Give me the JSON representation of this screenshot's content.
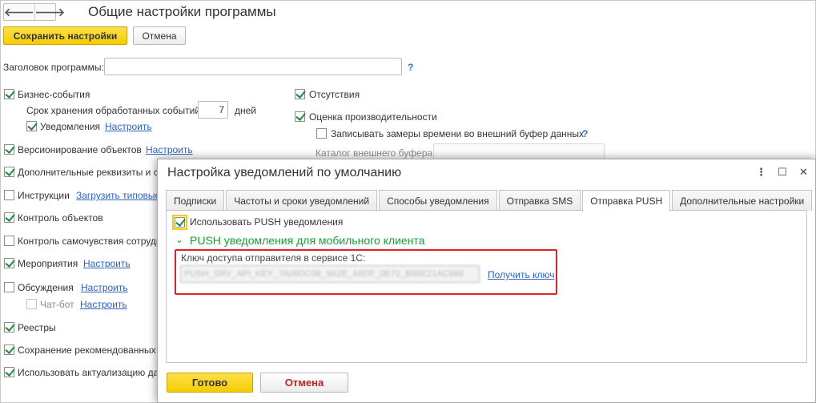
{
  "app": {
    "nav": {
      "back_glyph": "🡐",
      "forward_glyph": "🡒"
    },
    "title": "Общие настройки программы"
  },
  "toolbar": {
    "save_label": "Сохранить настройки",
    "cancel_label": "Отмена"
  },
  "header_field": {
    "label": "Заголовок программы:",
    "value": "",
    "help": "?"
  },
  "left_settings": {
    "business_events": {
      "label": "Бизнес-события",
      "checked": true
    },
    "retention": {
      "label": "Срок хранения обработанных событий:",
      "value": "7",
      "unit": "дней"
    },
    "notifications": {
      "label": "Уведомления",
      "link": "Настроить",
      "checked": true
    },
    "versioning": {
      "label": "Версионирование объектов",
      "link": "Настроить",
      "checked": true
    },
    "extra_attrs": {
      "label": "Дополнительные реквизиты и св",
      "checked": true
    },
    "instructions": {
      "label": "Инструкции",
      "link": "Загрузить типовые",
      "checked": false
    },
    "object_control": {
      "label": "Контроль объектов",
      "checked": true
    },
    "wellbeing": {
      "label": "Контроль самочувствия сотрудн",
      "checked": false
    },
    "events": {
      "label": "Мероприятия",
      "link": "Настроить",
      "checked": true
    },
    "discussions": {
      "label": "Обсуждения",
      "link": "Настроить",
      "checked": false
    },
    "chatbot": {
      "label": "Чат-бот",
      "link": "Настроить",
      "checked": false
    },
    "registers": {
      "label": "Реестры",
      "checked": true
    },
    "recommended": {
      "label": "Сохранение рекомендованных",
      "checked": true
    },
    "actualization": {
      "label": "Использовать актуализацию да",
      "checked": true
    }
  },
  "right_settings": {
    "absences": {
      "label": "Отсутствия",
      "checked": true
    },
    "performance": {
      "label": "Оценка производительности",
      "checked": true
    },
    "external_buffer": {
      "label": "Записывать замеры времени во внешний буфер данных",
      "checked": false,
      "help": "?"
    },
    "buffer_catalog": {
      "label": "Каталог внешнего буфера:",
      "value": ""
    }
  },
  "modal": {
    "title": "Настройка уведомлений по умолчанию",
    "controls": {
      "menu_glyph": "⋮",
      "maximize_glyph": "☐",
      "close_glyph": "✕"
    },
    "tabs": [
      {
        "label": "Подписки",
        "active": false
      },
      {
        "label": "Частоты и сроки уведомлений",
        "active": false
      },
      {
        "label": "Способы уведомления",
        "active": false
      },
      {
        "label": "Отправка SMS",
        "active": false
      },
      {
        "label": "Отправка PUSH",
        "active": true
      },
      {
        "label": "Дополнительные настройки",
        "active": false
      }
    ],
    "use_push": {
      "label": "Использовать PUSH уведомления",
      "checked": true
    },
    "group_title": "PUSH уведомления для мобильного клиента",
    "key_label": "Ключ доступа отправителя в сервисе 1С:",
    "key_value": "PUSH_SRV_API_KEY_7A06DC08_9A2E_A6DF_0E72_B98E21AC668",
    "get_key_link": "Получить ключ",
    "ok_label": "Готово",
    "cancel_label": "Отмена"
  },
  "colors": {
    "accent_yellow": "#f5cc00",
    "check_green": "#1f8c3a",
    "group_green": "#12a336",
    "link_blue": "#2b62c9",
    "highlight_red": "#d9262b",
    "cancel_red": "#c21f1f"
  }
}
